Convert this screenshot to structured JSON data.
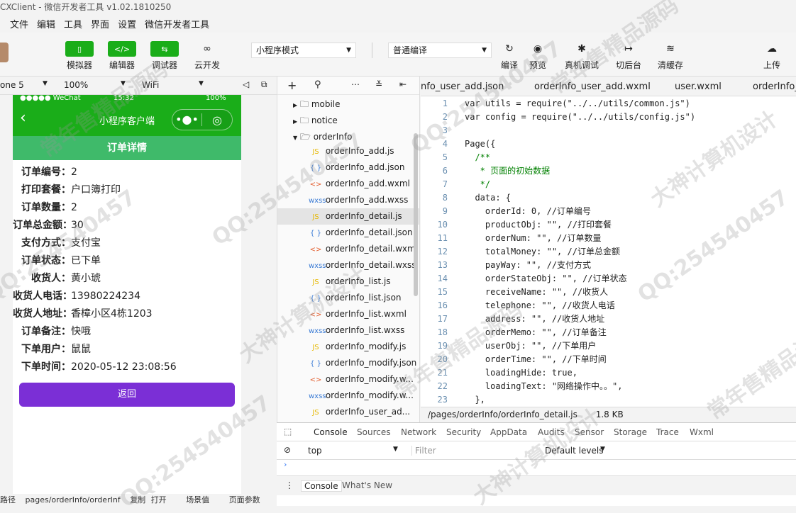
{
  "title": "CXClient - 微信开发者工具 v1.02.1810250",
  "menu": [
    "文件",
    "编辑",
    "工具",
    "界面",
    "设置",
    "微信开发者工具"
  ],
  "toolbar": {
    "simulator": "模拟器",
    "editor": "编辑器",
    "debugger": "调试器",
    "cloud": "云开发",
    "mode": "小程序模式",
    "compile": "普通编译",
    "compile_btn": "编译",
    "preview": "预览",
    "remote_debug": "真机调试",
    "background": "切后台",
    "clear_cache": "清缓存",
    "upload": "上传"
  },
  "device": {
    "model": "one 5",
    "zoom": "100%",
    "network": "WiFi"
  },
  "phone": {
    "status_left": "●●●●● WeChat",
    "status_time": "15:32",
    "status_battery": "100%",
    "nav_title": "小程序客户端",
    "header": "订单详情",
    "fields": [
      {
        "label": "订单编号：",
        "value": "2"
      },
      {
        "label": "打印套餐：",
        "value": "户口簿打印"
      },
      {
        "label": "订单数量：",
        "value": "2"
      },
      {
        "label": "订单总金额：",
        "value": "30"
      },
      {
        "label": "支付方式：",
        "value": "支付宝"
      },
      {
        "label": "订单状态：",
        "value": "已下单"
      },
      {
        "label": "收货人：",
        "value": "黄小琥"
      },
      {
        "label": "收货人电话：",
        "value": "13980224234"
      },
      {
        "label": "收货人地址：",
        "value": "香樟小区4栋1203"
      },
      {
        "label": "订单备注：",
        "value": "快哦"
      },
      {
        "label": "下单用户：",
        "value": "鼠鼠"
      },
      {
        "label": "下单时间：",
        "value": "2020-05-12 23:08:56"
      }
    ],
    "back_button": "返回"
  },
  "sim_bottom": {
    "path_label": "页面路径",
    "path": "pages/orderInfo/orderInf",
    "copy": "复制",
    "open": "打开",
    "scene": "场景值",
    "params": "页面参数"
  },
  "tree": {
    "folders": [
      "mobile",
      "notice",
      "orderInfo"
    ],
    "files": [
      {
        "type": "JS",
        "name": "orderInfo_add.js"
      },
      {
        "type": "{ }",
        "name": "orderInfo_add.json"
      },
      {
        "type": "<>",
        "name": "orderInfo_add.wxml"
      },
      {
        "type": "wxss",
        "name": "orderInfo_add.wxss"
      },
      {
        "type": "JS",
        "name": "orderInfo_detail.js"
      },
      {
        "type": "{ }",
        "name": "orderInfo_detail.json"
      },
      {
        "type": "<>",
        "name": "orderInfo_detail.wxml"
      },
      {
        "type": "wxss",
        "name": "orderInfo_detail.wxss"
      },
      {
        "type": "JS",
        "name": "orderInfo_list.js"
      },
      {
        "type": "{ }",
        "name": "orderInfo_list.json"
      },
      {
        "type": "<>",
        "name": "orderInfo_list.wxml"
      },
      {
        "type": "wxss",
        "name": "orderInfo_list.wxss"
      },
      {
        "type": "JS",
        "name": "orderInfo_modify.js"
      },
      {
        "type": "{ }",
        "name": "orderInfo_modify.json"
      },
      {
        "type": "<>",
        "name": "orderInfo_modify.w..."
      },
      {
        "type": "wxss",
        "name": "orderInfo_modify.w..."
      },
      {
        "type": "JS",
        "name": "orderInfo_user_ad..."
      }
    ]
  },
  "editor_tabs": [
    "nfo_user_add.json",
    "orderInfo_user_add.wxml",
    "user.wxml",
    "orderInfo_"
  ],
  "code": [
    "var utils = require(\"../../utils/common.js\")",
    "var config = require(\"../../utils/config.js\")",
    "",
    "Page({",
    "  /**",
    "   * 页面的初始数据",
    "   */",
    "  data: {",
    "    orderId: 0, //订单编号",
    "    productObj: \"\", //打印套餐",
    "    orderNum: \"\", //订单数量",
    "    totalMoney: \"\", //订单总金额",
    "    payWay: \"\", //支付方式",
    "    orderStateObj: \"\", //订单状态",
    "    receiveName: \"\", //收货人",
    "    telephone: \"\", //收货人电话",
    "    address: \"\", //收货人地址",
    "    orderMemo: \"\", //订单备注",
    "    userObj: \"\", //下单用户",
    "    orderTime: \"\", //下单时间",
    "    loadingHide: true,",
    "    loadingText: \"网络操作中。。\",",
    "  },"
  ],
  "editor_status": {
    "path": "/pages/orderInfo/orderInfo_detail.js",
    "size": "1.8 KB"
  },
  "console": {
    "tabs": [
      "Console",
      "Sources",
      "Network",
      "Security",
      "AppData",
      "Audits",
      "Sensor",
      "Storage",
      "Trace",
      "Wxml"
    ],
    "context": "top",
    "filter_placeholder": "Filter",
    "levels": "Default levels",
    "drawer_tabs": [
      "Console",
      "What's New"
    ]
  },
  "watermarks": [
    "QQ:254540457",
    "大神计算机设计",
    "常年售精品源码"
  ]
}
